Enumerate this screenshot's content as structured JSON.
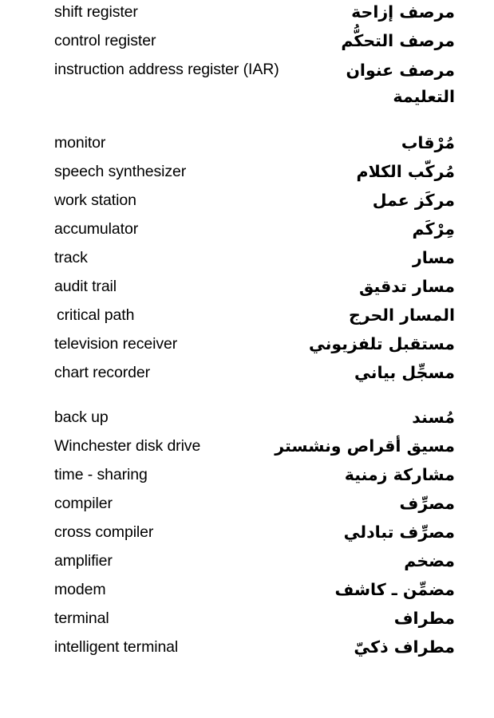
{
  "page": {
    "background": "#ffffff",
    "text_color": "#000000",
    "language_left": "English",
    "language_right": "Arabic"
  },
  "groups": [
    {
      "id": "registers",
      "entries": [
        {
          "term": "shift register",
          "arabic": "مرصف إزاحة"
        },
        {
          "term": "control register",
          "arabic": "مرصف التحكُّم"
        },
        {
          "term": "instruction address register (IAR)",
          "arabic": "مرصف عنوان",
          "arabic_line2": "التعليمة"
        }
      ]
    },
    {
      "id": "devices",
      "entries": [
        {
          "term": "monitor",
          "arabic": "مُرْقاب"
        },
        {
          "term": "speech synthesizer",
          "arabic": "مُركّب الكلام"
        },
        {
          "term": "work  station",
          "arabic": "مركَز عمل"
        },
        {
          "term": "accumulator",
          "arabic": "مِرْكَم"
        },
        {
          "term": "track",
          "arabic": "مسار"
        },
        {
          "term": "audit trail",
          "arabic": "مسار تدقيق"
        },
        {
          "term": "critical path",
          "arabic": "المسار الحرج",
          "indent": true
        },
        {
          "term": "television receiver",
          "arabic": "مستقبل تلفزيوني"
        },
        {
          "term": "chart recorder",
          "arabic": "مسجِّل بياني"
        }
      ]
    },
    {
      "id": "software-hardware",
      "entries": [
        {
          "term": "back up",
          "arabic": "مُسند"
        },
        {
          "term": "Winchester disk drive",
          "arabic": "مسيق أقراص ونشستر"
        },
        {
          "term": "time - sharing",
          "arabic": "مشاركة زمنية"
        },
        {
          "term": "compiler",
          "arabic": "مصرِّف"
        },
        {
          "term": "cross compiler",
          "arabic": "مصرِّف تبادلي"
        },
        {
          "term": "amplifier",
          "arabic": "مضخم"
        },
        {
          "term": "modem",
          "arabic": "مضمِّن ـ كاشف"
        },
        {
          "term": "terminal",
          "arabic": "مطراف"
        },
        {
          "term": "intelligent terminal",
          "arabic": "مطراف ذكيّ"
        }
      ]
    }
  ]
}
